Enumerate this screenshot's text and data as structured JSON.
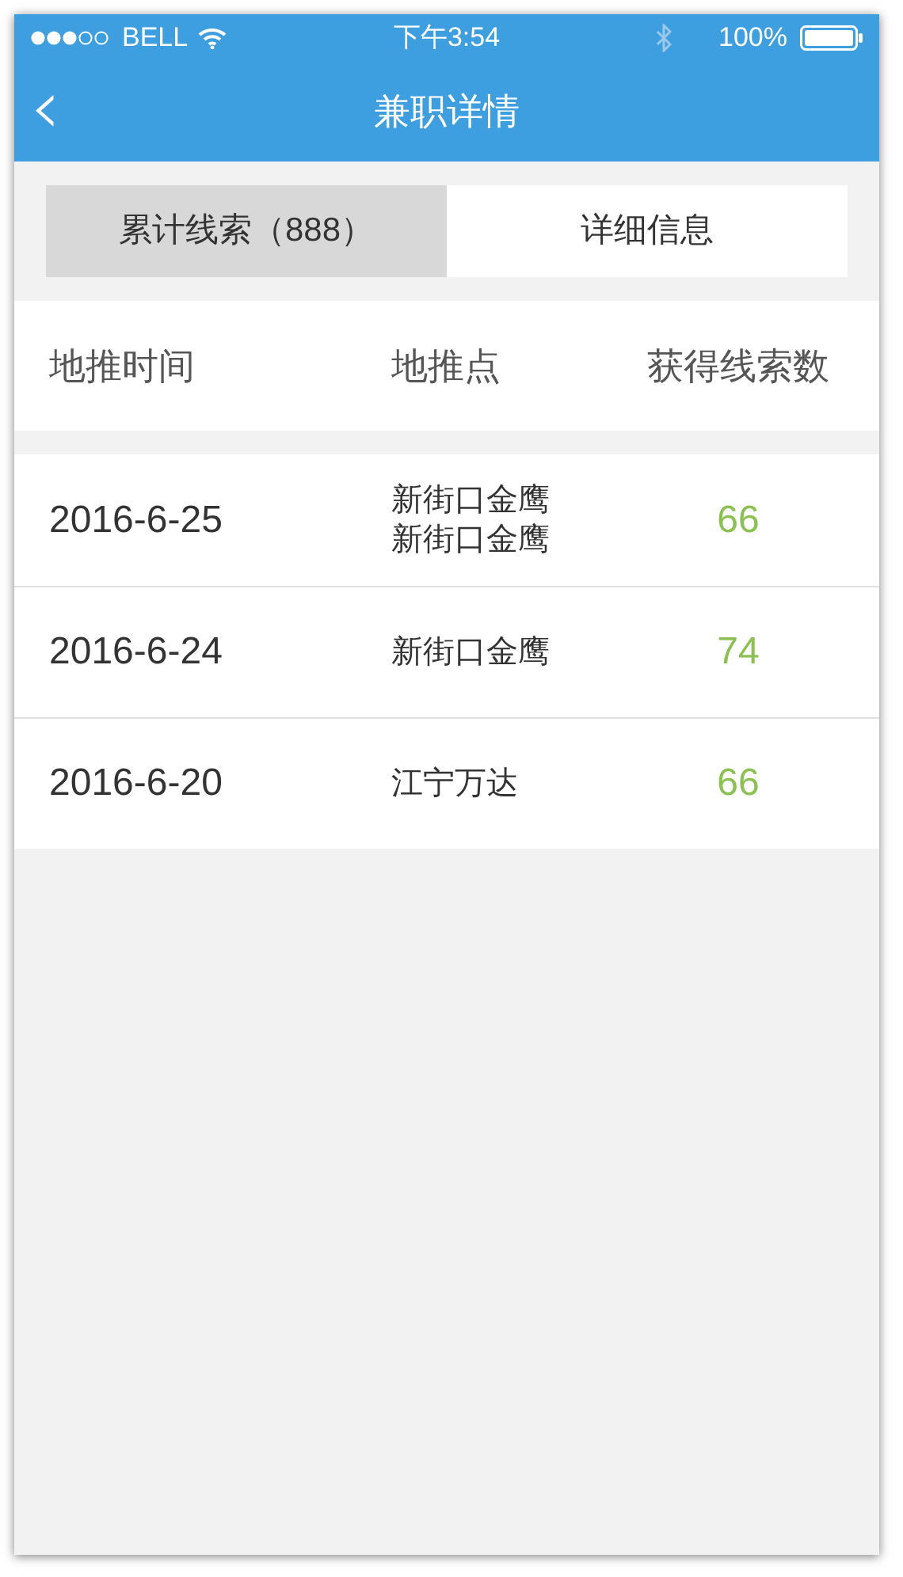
{
  "status_bar": {
    "carrier": "BELL",
    "time": "下午3:54",
    "battery": "100%"
  },
  "nav_bar": {
    "back": "‹",
    "title": "兼职详情"
  },
  "tabs": [
    {
      "label": "累计线索（888）",
      "selected": true
    },
    {
      "label": "详细信息",
      "selected": false
    }
  ],
  "table": {
    "columns": [
      "地推时间",
      "地推点",
      "获得线索数"
    ],
    "rows": [
      {
        "date": "2016-6-25",
        "places": [
          "新街口金鹰",
          "新街口金鹰"
        ],
        "count": "66"
      },
      {
        "date": "2016-6-24",
        "places": [
          "新街口金鹰"
        ],
        "count": "74"
      },
      {
        "date": "2016-6-20",
        "places": [
          "江宁万达"
        ],
        "count": "66"
      }
    ]
  }
}
